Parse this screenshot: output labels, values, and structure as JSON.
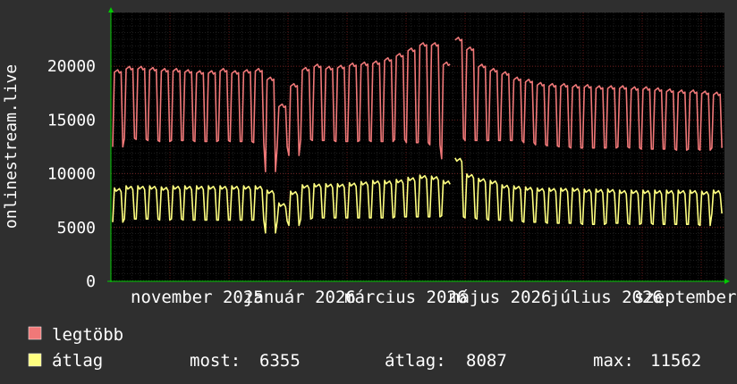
{
  "chart_data": {
    "type": "line",
    "ylabel": "onlinestream.live",
    "ylim": [
      0,
      25000
    ],
    "y_ticks": [
      "0",
      "5000",
      "10000",
      "15000",
      "20000"
    ],
    "x_tick_labels": [
      "november 2025",
      "január 2026",
      "március 2026",
      "május 2026",
      "július 2026",
      "szeptember"
    ],
    "grid": true,
    "legend_position": "bottom-left",
    "series": [
      {
        "name": "legtöbb",
        "color": "#f07878",
        "weekly_high": [
          19500,
          19800,
          19800,
          19700,
          19600,
          19600,
          19500,
          19400,
          19400,
          19600,
          19400,
          19500,
          19600,
          18800,
          16300,
          18200,
          19700,
          20000,
          19800,
          19900,
          20100,
          20200,
          20300,
          20600,
          21000,
          21500,
          22000,
          22000,
          20200,
          22500,
          21600,
          20000,
          19600,
          19300,
          18800,
          18600,
          18300,
          18200,
          18200,
          18100,
          18100,
          18000,
          18000,
          18000,
          17900,
          17900,
          17800,
          17700,
          17600,
          17600,
          17500,
          17400
        ],
        "weekly_low": [
          12500,
          13300,
          13200,
          13100,
          13000,
          13100,
          13100,
          13000,
          13000,
          13100,
          13000,
          13000,
          12900,
          10200,
          12500,
          11700,
          13200,
          13100,
          13100,
          13000,
          13000,
          13100,
          13000,
          13000,
          13200,
          12900,
          12900,
          12700,
          11400,
          13300,
          13100,
          13100,
          13100,
          13100,
          13100,
          12900,
          12700,
          12600,
          12500,
          12400,
          12400,
          12400,
          12400,
          12500,
          12400,
          12300,
          12300,
          12300,
          12200,
          12300,
          12200,
          12400
        ]
      },
      {
        "name": "átlag",
        "color": "#ffff80",
        "weekly_high": [
          8500,
          8700,
          8700,
          8700,
          8600,
          8700,
          8700,
          8700,
          8700,
          8700,
          8700,
          8700,
          8700,
          8300,
          7100,
          8200,
          8800,
          8900,
          8900,
          8900,
          9000,
          9100,
          9200,
          9200,
          9300,
          9500,
          9700,
          9600,
          9200,
          11300,
          9800,
          9400,
          9200,
          8800,
          8700,
          8600,
          8500,
          8500,
          8500,
          8500,
          8400,
          8400,
          8400,
          8300,
          8300,
          8300,
          8300,
          8300,
          8300,
          8300,
          8200,
          8300
        ],
        "weekly_low": [
          5500,
          5800,
          5800,
          5800,
          5700,
          5800,
          5700,
          5700,
          5700,
          5700,
          5700,
          5700,
          5700,
          4500,
          5600,
          5200,
          5800,
          5900,
          5900,
          5900,
          5900,
          5900,
          5900,
          5900,
          6000,
          6000,
          6000,
          6000,
          6100,
          6000,
          5900,
          5800,
          5700,
          5700,
          5600,
          5500,
          5500,
          5400,
          5400,
          5400,
          5300,
          5300,
          5400,
          5400,
          5300,
          5400,
          5300,
          5300,
          5300,
          5300,
          5200,
          6300
        ]
      }
    ]
  },
  "legend": {
    "items": [
      {
        "label": "legtöbb",
        "color": "#f07878"
      },
      {
        "label": "átlag",
        "color": "#ffff80"
      }
    ],
    "stats": {
      "most_label": "most:",
      "most_value": "6355",
      "atlag_label": "átlag:",
      "atlag_value": "8087",
      "max_label": "max:",
      "max_value": "11562"
    }
  },
  "theme": {
    "background": "#2f2f2f",
    "plot_background": "#000000",
    "grid_major": "#7a1c1c",
    "grid_minor": "#3a3a3a",
    "axis_arrow": "#00cc00",
    "text": "#ffffff"
  }
}
